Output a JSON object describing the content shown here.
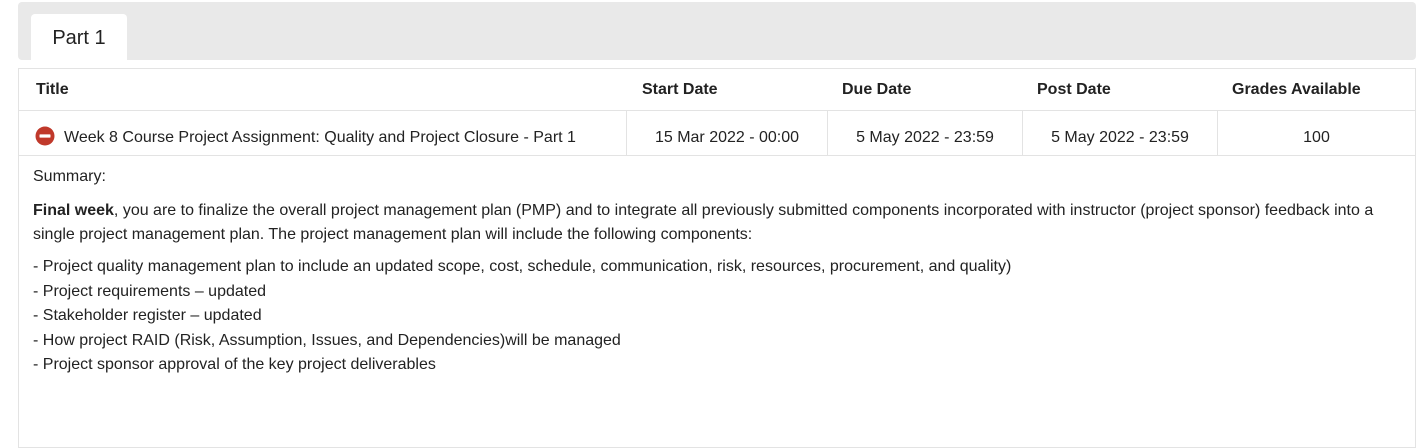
{
  "tabs": [
    {
      "label": "Part 1",
      "active": true
    }
  ],
  "table": {
    "headers": {
      "title": "Title",
      "start_date": "Start Date",
      "due_date": "Due Date",
      "post_date": "Post Date",
      "grades_available": "Grades Available"
    },
    "rows": [
      {
        "status_icon": "remove-circle-icon",
        "status_color": "#c0392b",
        "title": "Week 8 Course Project Assignment: Quality and Project Closure - Part 1",
        "start_date": "15 Mar 2022 - 00:00",
        "due_date": "5 May 2022 - 23:59",
        "post_date": "5 May 2022 - 23:59",
        "grades_available": "100"
      }
    ]
  },
  "summary": {
    "label": "Summary:",
    "intro_bold": "Final week",
    "intro_rest": ", you are to finalize the overall project management plan (PMP) and to integrate all previously submitted components incorporated with instructor (project sponsor) feedback into a single project management plan. The project management plan will include the following components:",
    "items": [
      "- Project quality management plan to include an updated scope, cost, schedule, communication, risk, resources, procurement, and quality)",
      "- Project requirements – updated",
      "- Stakeholder register – updated",
      "- How project RAID (Risk, Assumption, Issues, and Dependencies)will be managed",
      "- Project sponsor approval of the key project deliverables"
    ]
  },
  "colors": {
    "tabbar_bg": "#e9e9e9",
    "border": "#e3e3e3",
    "text": "#222222",
    "status_red": "#c0392b"
  }
}
